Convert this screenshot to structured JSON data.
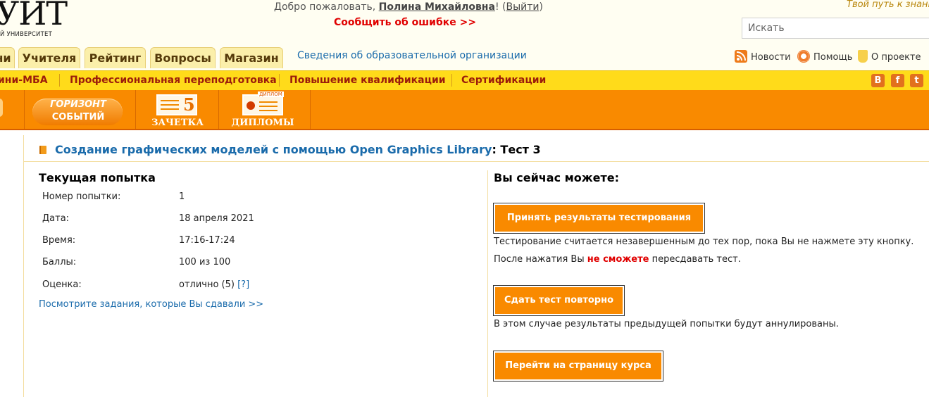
{
  "header": {
    "logo_big": "УИТ",
    "logo_small": "Й УНИВЕРСИТЕТ",
    "welcome_prefix": "Добро пожаловать, ",
    "user_name": "Полина Михайловна",
    "welcome_mid": "! (",
    "logout_label": "Выйти",
    "welcome_suffix": ")",
    "report_error": "Сообщить об ошибке >>",
    "tagline": "Твой путь к знаниям",
    "search_placeholder": "Искать"
  },
  "tabs": [
    "ни",
    "Учителя",
    "Рейтинг",
    "Вопросы",
    "Магазин"
  ],
  "org_info_link": "Сведения об образовательной организации",
  "utility_links": {
    "news": "Новости",
    "help": "Помощь",
    "about": "О проекте"
  },
  "nav": [
    "ини-МБА",
    "Профессиональная переподготовка",
    "Повышение квалификации",
    "Сертификации"
  ],
  "social": {
    "vk": "В",
    "fb": "f",
    "tw": "t"
  },
  "banner": {
    "horizon_line1": "ГОРИЗОНТ",
    "horizon_line2": "СОБЫТИЙ",
    "zachetka_digit": "5",
    "zachetka_label": "ЗАЧЕТКА",
    "diplomy_mini": "ДИПЛОМ",
    "diplomy_label": "ДИПЛОМЫ"
  },
  "page": {
    "course_title": "Создание графических моделей с помощью Open Graphics Library",
    "test_suffix": ": Тест 3"
  },
  "attempt": {
    "heading": "Текущая попытка",
    "rows": [
      {
        "label": "Номер попытки:",
        "value": "1"
      },
      {
        "label": "Дата:",
        "value": "18 апреля 2021"
      },
      {
        "label": "Время:",
        "value": "17:16-17:24"
      },
      {
        "label": "Баллы:",
        "value": "100 из 100"
      },
      {
        "label": "Оценка:",
        "value": "отлично (5)"
      }
    ],
    "grade_help": "[?]",
    "view_tasks_link": "Посмотрите задания, которые Вы сдавали >>"
  },
  "actions": {
    "heading": "Вы сейчас можете:",
    "accept_label": "Принять результаты тестирования",
    "accept_note": "Тестирование считается незавершенным до тех пор, пока Вы не нажмете эту кнопку.",
    "warn_prefix": "После нажатия Вы ",
    "warn_emphasis": "не сможете",
    "warn_suffix": " пересдавать тест.",
    "retake_label": "Сдать тест повторно",
    "retake_note": "В этом случае результаты предыдущей попытки будут аннулированы.",
    "course_page_label": "Перейти на страницу курса"
  },
  "colors": {
    "accent_orange": "#f98a00",
    "nav_yellow": "#ffdb1a",
    "link_blue": "#1a6bab",
    "error_red": "#e00000"
  }
}
